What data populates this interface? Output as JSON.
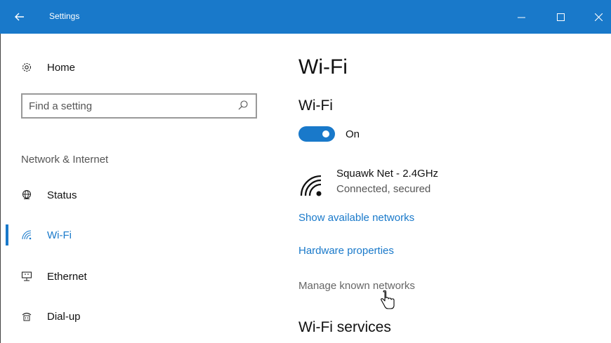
{
  "window": {
    "title": "Settings",
    "back_icon": "back-arrow-icon",
    "controls": [
      "minimize",
      "maximize",
      "close"
    ],
    "accent_color": "#1979ca"
  },
  "sidebar": {
    "home_label": "Home",
    "search_placeholder": "Find a setting",
    "section_label": "Network & Internet",
    "items": [
      {
        "label": "Status",
        "icon": "globe-icon"
      },
      {
        "label": "Wi-Fi",
        "icon": "wifi-icon",
        "selected": true
      },
      {
        "label": "Ethernet",
        "icon": "ethernet-icon"
      },
      {
        "label": "Dial-up",
        "icon": "dialup-icon"
      }
    ]
  },
  "main": {
    "title": "Wi-Fi",
    "wifi_heading": "Wi-Fi",
    "toggle_state": "On",
    "toggle_on": true,
    "network": {
      "name": "Squawk Net - 2.4GHz",
      "status": "Connected, secured"
    },
    "links": {
      "show_networks": "Show available networks",
      "hardware": "Hardware properties",
      "manage": "Manage known networks"
    },
    "services_heading": "Wi-Fi services"
  }
}
